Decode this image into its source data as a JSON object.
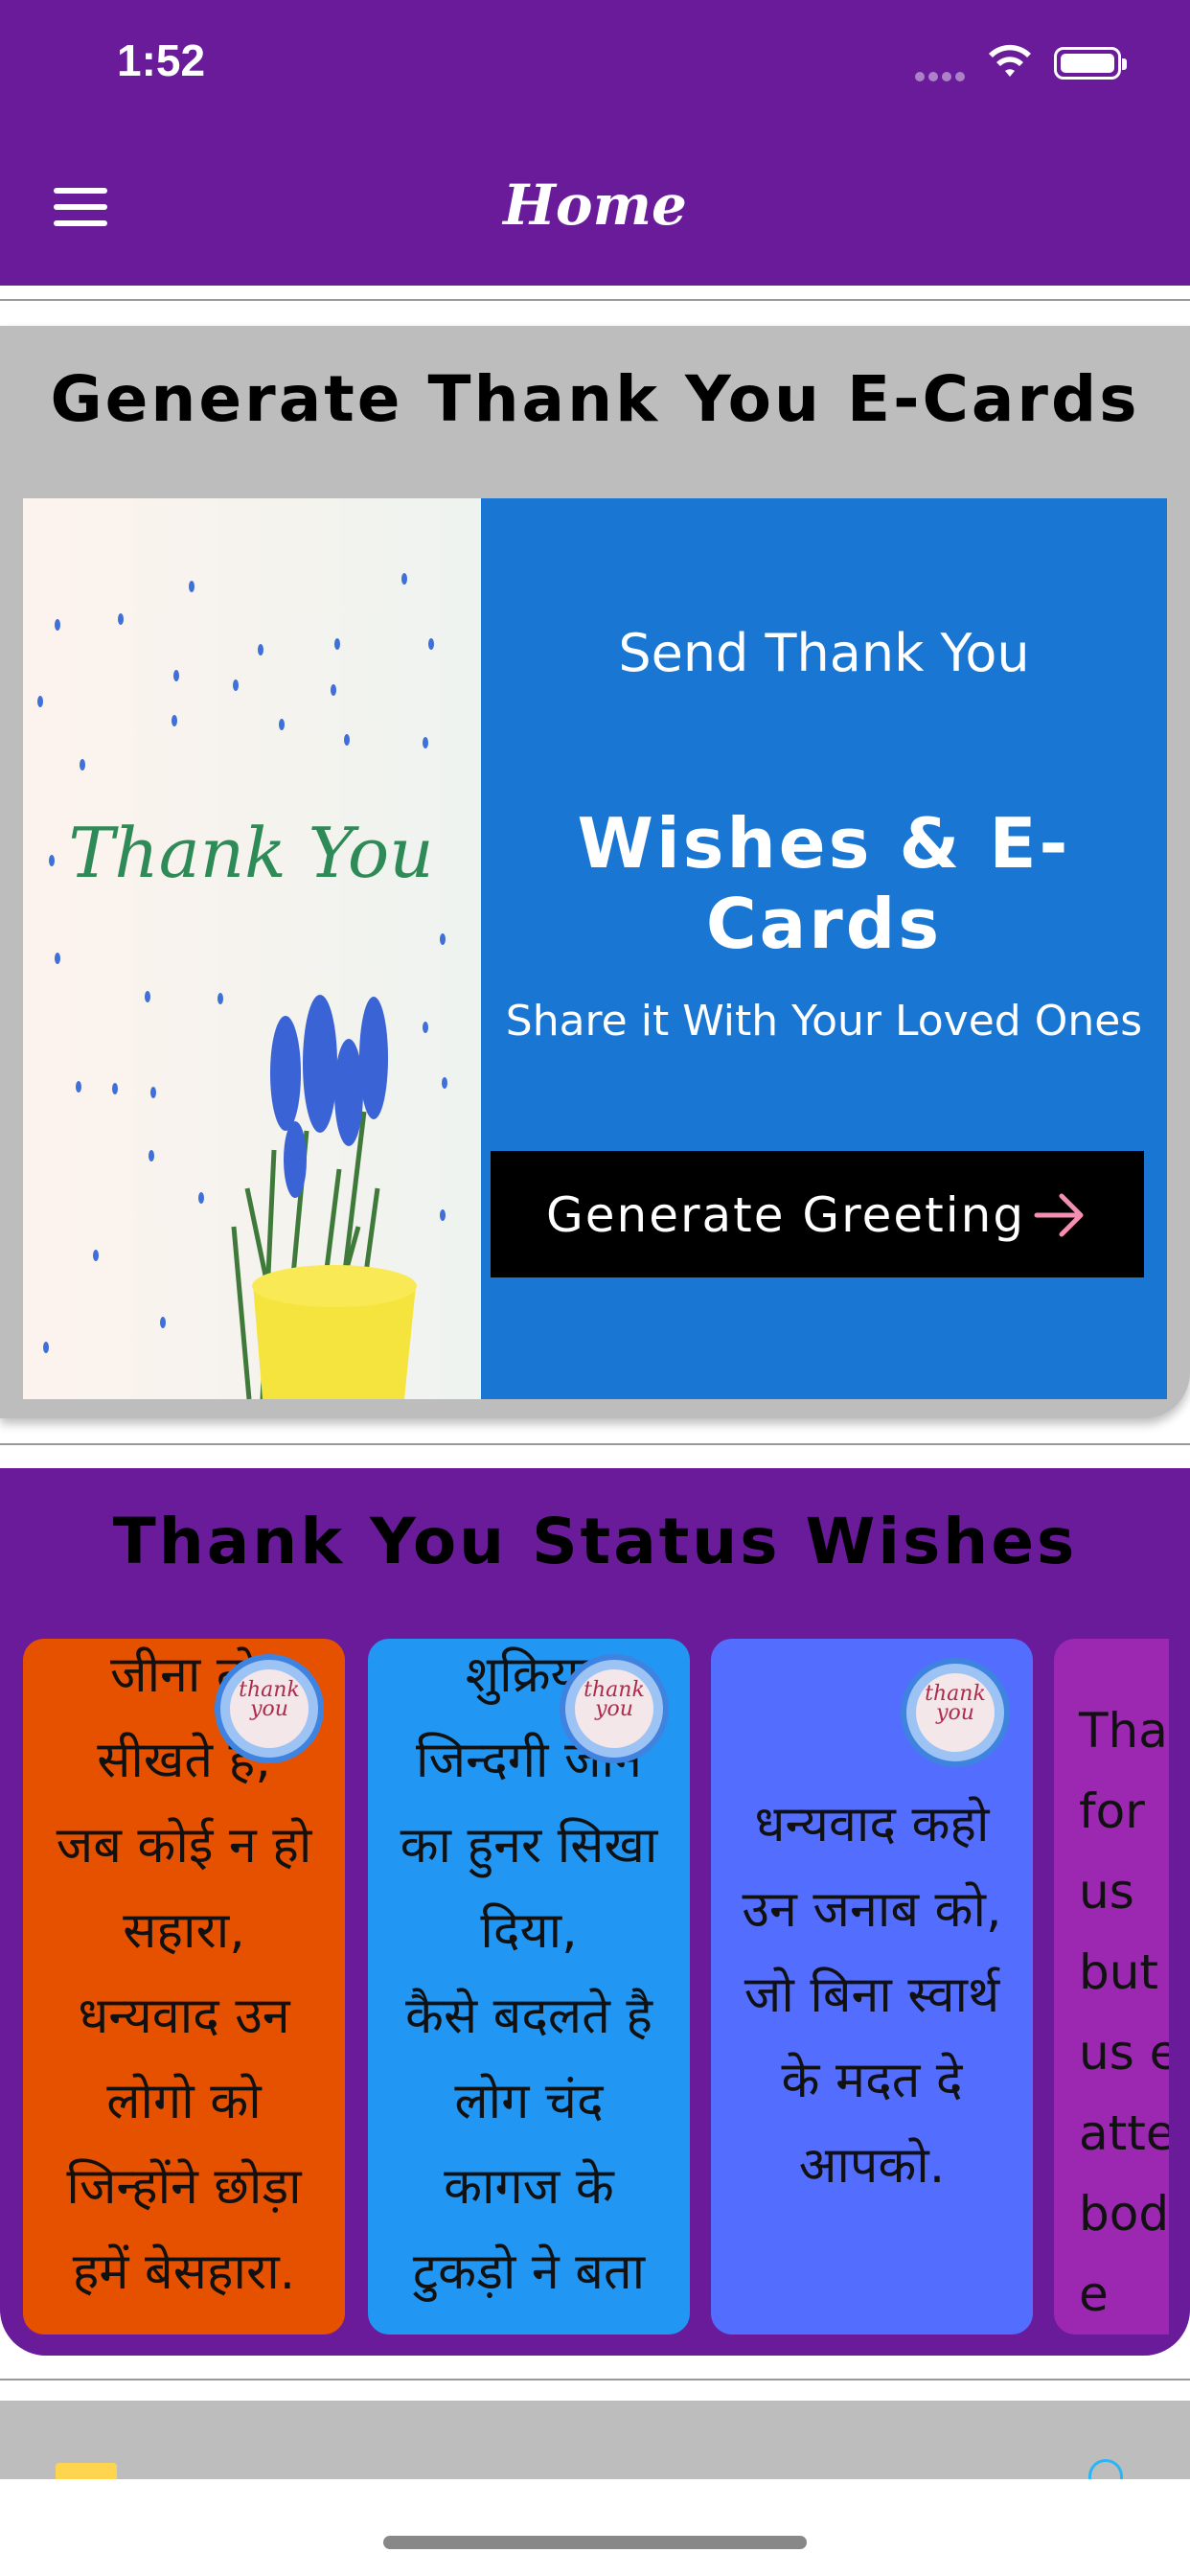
{
  "status_bar": {
    "time": "1:52"
  },
  "header": {
    "title": "Home"
  },
  "ecard_section": {
    "title": "Generate Thank You E-Cards",
    "image_text": "Thank You",
    "line1": "Send Thank You",
    "line2": "Wishes & E-Cards",
    "line3": "Share it With Your Loved Ones",
    "button_label": "Generate Greeting"
  },
  "status_section": {
    "title": "Thank You Status Wishes",
    "cards": [
      {
        "text": "जीना तो\nसीखते है,\nजब कोई न हो\nसहारा,\nधन्यवाद उन\nलोगो को\nजिन्होंने छोड़ा\nहमें बेसहारा.",
        "color": "#e65100",
        "badge": "thank you"
      },
      {
        "text": "शुक्रिया\nजिन्दगी जीने\nका हुनर सिखा\nदिया,\nकैसे बदलते है\nलोग चंद\nकागज के\nटुकड़ो ने बता",
        "color": "#2196f3",
        "badge": "thank you"
      },
      {
        "text": "धन्यवाद कहो\nउन जनाब को,\nजो बिना स्वार्थ\nके मदत दे\nआपको.",
        "color": "#536dfe",
        "badge": "thank you"
      },
      {
        "text": "Thank\nfor\nus\nbut\nus e\nattent\nbod\ne",
        "color": "#9c27b0",
        "badge": ""
      }
    ]
  },
  "colors": {
    "primary": "#6a1b9a",
    "card_gray": "#bdbdbd",
    "ecard_blue": "#1976d2",
    "button_black": "#000000",
    "arrow_pink": "#f48fb1"
  },
  "icons": [
    "menu-icon",
    "wifi-icon",
    "battery-icon",
    "arrow-right-icon",
    "info-icon"
  ]
}
